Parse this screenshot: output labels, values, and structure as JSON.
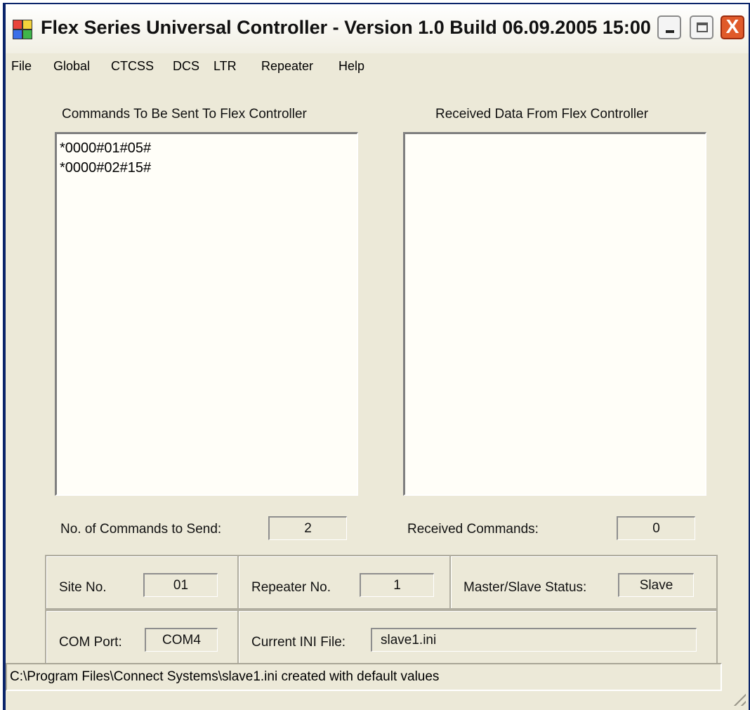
{
  "window": {
    "title": "Flex Series Universal Controller - Version 1.0 Build 06.09.2005 15:00",
    "close_glyph": "X"
  },
  "menu": [
    "File",
    "Global",
    "CTCSS",
    "DCS",
    "LTR",
    "Repeater",
    "Help"
  ],
  "commands_panel": {
    "label": "Commands To Be Sent To Flex Controller",
    "lines": [
      "*0000#01#05#",
      "*0000#02#15#"
    ]
  },
  "received_panel": {
    "label": "Received Data From Flex Controller",
    "lines": []
  },
  "counts": {
    "send_label": "No. of Commands to Send:",
    "send_value": "2",
    "received_label": "Received Commands:",
    "received_value": "0"
  },
  "site": {
    "label": "Site No.",
    "value": "01"
  },
  "repeater": {
    "label": "Repeater No.",
    "value": "1"
  },
  "master_slave": {
    "label": "Master/Slave Status:",
    "value": "Slave"
  },
  "com_port": {
    "label": "COM Port:",
    "value": "COM4"
  },
  "ini_file": {
    "label": "Current INI File:",
    "value": "slave1.ini"
  },
  "status_bar": {
    "text": "C:\\Program Files\\Connect Systems\\slave1.ini  created with default values"
  },
  "colors": {
    "title_frame": "#0a246a",
    "window_bg": "#ece9d8",
    "list_bg": "#fffef8",
    "close_button": "#e05a2a"
  }
}
